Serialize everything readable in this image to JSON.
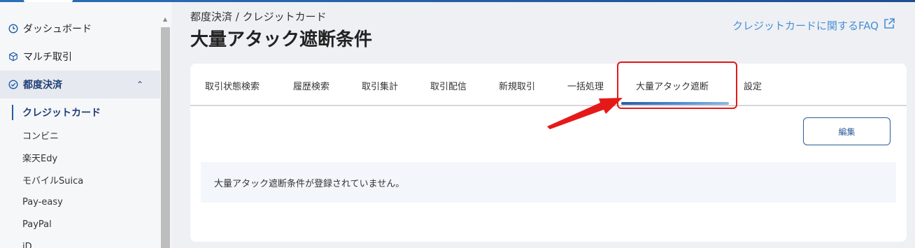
{
  "sidebar": {
    "items": [
      {
        "label": "ダッシュボード",
        "icon": "clock-icon"
      },
      {
        "label": "マルチ取引",
        "icon": "cube-icon"
      },
      {
        "label": "都度決済",
        "icon": "check-circle-icon",
        "expanded": true
      }
    ],
    "sub_items": [
      {
        "label": "クレジットカード",
        "current": true
      },
      {
        "label": "コンビニ"
      },
      {
        "label": "楽天Edy"
      },
      {
        "label": "モバイルSuica"
      },
      {
        "label": "Pay-easy"
      },
      {
        "label": "PayPal"
      },
      {
        "label": "iD"
      }
    ]
  },
  "header": {
    "breadcrumb": "都度決済 / クレジットカード",
    "title": "大量アタック遮断条件",
    "faq_link": "クレジットカードに関するFAQ"
  },
  "tabs": [
    {
      "label": "取引状態検索"
    },
    {
      "label": "履歴検索"
    },
    {
      "label": "取引集計"
    },
    {
      "label": "取引配信"
    },
    {
      "label": "新規取引"
    },
    {
      "label": "一括処理"
    },
    {
      "label": "大量アタック遮断",
      "active": true
    },
    {
      "label": "設定"
    }
  ],
  "content": {
    "edit_button": "編集",
    "notice": "大量アタック遮断条件が登録されていません。"
  },
  "colors": {
    "accent": "#1f3f75",
    "link": "#4a8fd4",
    "highlight": "#e61919"
  }
}
